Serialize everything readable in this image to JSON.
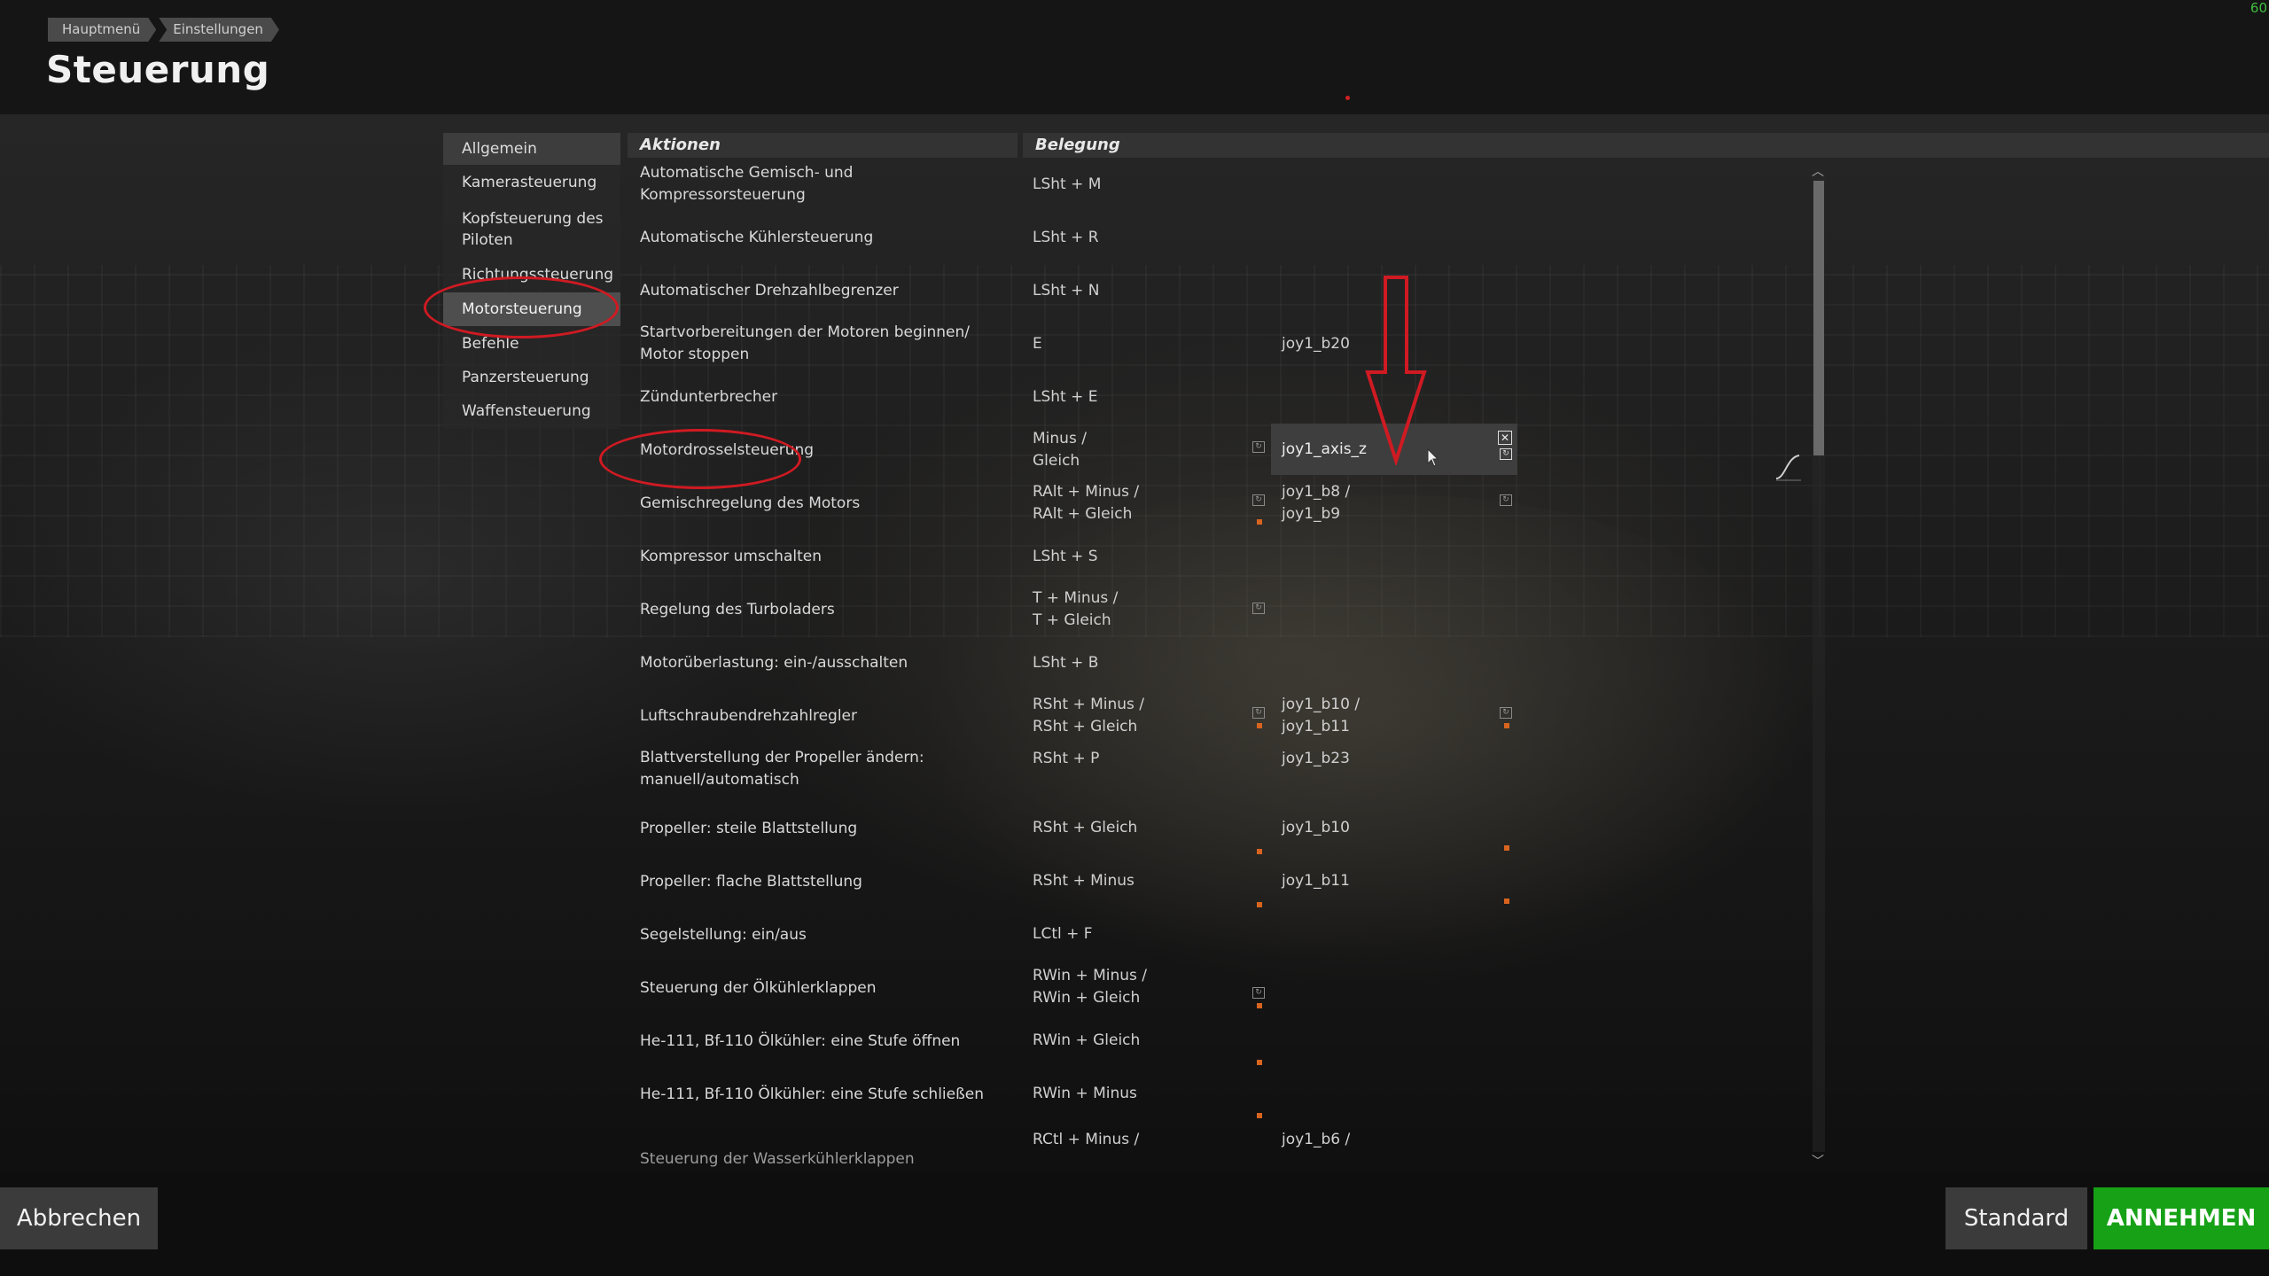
{
  "header": {
    "breadcrumb": [
      "Hauptmenü",
      "Einstellungen"
    ],
    "title": "Steuerung",
    "fps": "60"
  },
  "sidebar": {
    "items": [
      {
        "label": "Allgemein"
      },
      {
        "label": "Kamerasteuerung"
      },
      {
        "label": "Kopfsteuerung des Piloten"
      },
      {
        "label": "Richtungssteuerung"
      },
      {
        "label": "Motorsteuerung",
        "selected": true
      },
      {
        "label": "Befehle"
      },
      {
        "label": "Panzersteuerung"
      },
      {
        "label": "Waffensteuerung"
      }
    ]
  },
  "table": {
    "col_actions": "Aktionen",
    "col_binding": "Belegung",
    "rows": [
      {
        "action": "Automatische Gemisch- und Kompressorsteuerung",
        "primary": "LSht + M",
        "secondary": ""
      },
      {
        "action": "Automatische Kühlersteuerung",
        "primary": "LSht + R",
        "secondary": ""
      },
      {
        "action": "Automatischer Drehzahlbegrenzer",
        "primary": "LSht + N",
        "secondary": ""
      },
      {
        "action": "Startvorbereitungen der Motoren beginnen/ Motor stoppen",
        "primary": "E",
        "secondary": "joy1_b20"
      },
      {
        "action": "Zündunterbrecher",
        "primary": "LSht + E",
        "secondary": ""
      },
      {
        "action": "Motordrosselsteuerung",
        "primary": "Minus /\nGleich",
        "secondary": "joy1_axis_z",
        "editing": true
      },
      {
        "action": "Gemischregelung des Motors",
        "primary": "RAlt + Minus /\nRAlt + Gleich",
        "secondary": "joy1_b8 /\njoy1_b9"
      },
      {
        "action": "Kompressor umschalten",
        "primary": "LSht + S",
        "secondary": ""
      },
      {
        "action": "Regelung des Turboladers",
        "primary": "T + Minus /\nT + Gleich",
        "secondary": ""
      },
      {
        "action": "Motorüberlastung: ein-/ausschalten",
        "primary": "LSht + B",
        "secondary": ""
      },
      {
        "action": "Luftschraubendrehzahlregler",
        "primary": "RSht + Minus /\nRSht + Gleich",
        "secondary": "joy1_b10 /\njoy1_b11"
      },
      {
        "action": "Blattverstellung der Propeller ändern: manuell/automatisch",
        "primary": "RSht + P",
        "secondary": "joy1_b23"
      },
      {
        "action": "Propeller: steile Blattstellung",
        "primary": "RSht + Gleich",
        "secondary": "joy1_b10"
      },
      {
        "action": "Propeller: flache Blattstellung",
        "primary": "RSht + Minus",
        "secondary": "joy1_b11"
      },
      {
        "action": "Segelstellung: ein/aus",
        "primary": "LCtl + F",
        "secondary": ""
      },
      {
        "action": "Steuerung der Ölkühlerklappen",
        "primary": "RWin + Minus /\nRWin + Gleich",
        "secondary": ""
      },
      {
        "action": "He-111, Bf-110 Ölkühler: eine Stufe öffnen",
        "primary": "RWin + Gleich",
        "secondary": ""
      },
      {
        "action": "He-111, Bf-110 Ölkühler: eine Stufe schließen",
        "primary": "RWin + Minus",
        "secondary": ""
      },
      {
        "action": "Steuerung der Wasserkühlerklappen",
        "primary": "RCtl + Minus /",
        "secondary": "joy1_b6 /"
      }
    ]
  },
  "footer": {
    "cancel": "Abbrechen",
    "default": "Standard",
    "accept": "ANNEHMEN"
  },
  "colors": {
    "accent_green": "#16a117",
    "annotation_red": "#d01a22",
    "fps_green": "#3fbf3f"
  }
}
